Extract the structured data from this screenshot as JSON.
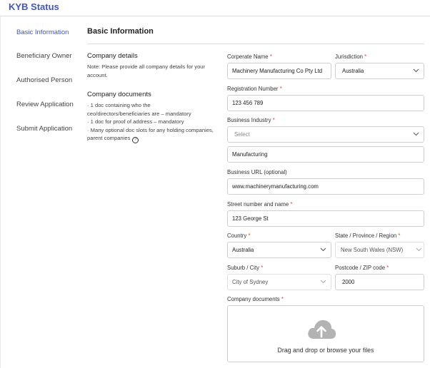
{
  "app": {
    "title": "KYB Status"
  },
  "sidebar": {
    "items": [
      {
        "label": "Basic Information"
      },
      {
        "label": "Beneficiary Owner"
      },
      {
        "label": "Authorised Person"
      },
      {
        "label": "Review Application"
      },
      {
        "label": "Submit Application"
      }
    ],
    "active_index": 0
  },
  "main": {
    "title": "Basic Information",
    "company_details": {
      "title": "Company details",
      "note_line1": "Note: Please provide all company details for your",
      "note_line2": "account."
    },
    "company_documents": {
      "title": "Company documents",
      "line1": "· 1 doc containing who the",
      "line2": "ceo/directors/beneficiaries are – mandatory",
      "line3": "· 1 doc for proof of address – mandatory",
      "line4": "· Many optional doc slots for any holding companies,",
      "line5": "parent companies"
    }
  },
  "form": {
    "required_mark": "*",
    "corporate_name": {
      "label": "Corperate Name",
      "value": "Machinery Manufacturing Co Pty Ltd"
    },
    "jurisdiction": {
      "label": "Jurisdiction",
      "value": "Australia"
    },
    "registration_number": {
      "label": "Registration Number",
      "value": "123 456 789"
    },
    "business_industry": {
      "label": "Business Industry",
      "placeholder": "Select",
      "value": "Manufacturing"
    },
    "business_url": {
      "label": "Business URL (optional)",
      "value": "www.machinerymanufacturing.com"
    },
    "street": {
      "label": "Street number and name",
      "value": "123 George St"
    },
    "country": {
      "label": "Country",
      "value": "Australia"
    },
    "state": {
      "label": "State / Province / Region",
      "value": "New South Wales (NSW)"
    },
    "suburb": {
      "label": "Suburb / City",
      "value": "City of Sydney"
    },
    "postcode": {
      "label": "Postcode / ZIP code",
      "value": "2000"
    },
    "documents": {
      "label": "Company documents",
      "dropzone_text": "Drag and drop or browse your files"
    }
  },
  "icons": {
    "upload": "cloud-upload-icon",
    "chevron": "chevron-down-icon",
    "help": "question-circle-icon"
  },
  "colors": {
    "accent": "#3f56c4",
    "required": "#e0453a",
    "cloud": "#b3b3b3"
  }
}
